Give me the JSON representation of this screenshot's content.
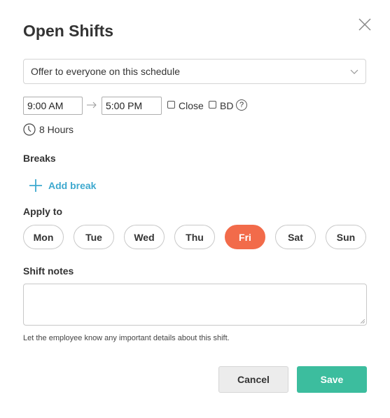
{
  "modal": {
    "title": "Open Shifts"
  },
  "offer_select": {
    "value": "Offer to everyone on this schedule"
  },
  "time": {
    "start": "9:00 AM",
    "end": "5:00 PM",
    "close_label": "Close",
    "bd_label": "BD",
    "help_glyph": "?"
  },
  "duration": {
    "text": "8 Hours"
  },
  "breaks": {
    "label": "Breaks",
    "add_label": "Add break"
  },
  "apply_to": {
    "label": "Apply to",
    "days": [
      {
        "label": "Mon",
        "active": false
      },
      {
        "label": "Tue",
        "active": false
      },
      {
        "label": "Wed",
        "active": false
      },
      {
        "label": "Thu",
        "active": false
      },
      {
        "label": "Fri",
        "active": true
      },
      {
        "label": "Sat",
        "active": false
      },
      {
        "label": "Sun",
        "active": false
      }
    ]
  },
  "notes": {
    "label": "Shift notes",
    "value": "",
    "hint": "Let the employee know any important details about this shift."
  },
  "actions": {
    "cancel": "Cancel",
    "save": "Save"
  },
  "colors": {
    "accent": "#3ea9cf",
    "active_day": "#f26b4a",
    "save": "#3cbd9e"
  }
}
